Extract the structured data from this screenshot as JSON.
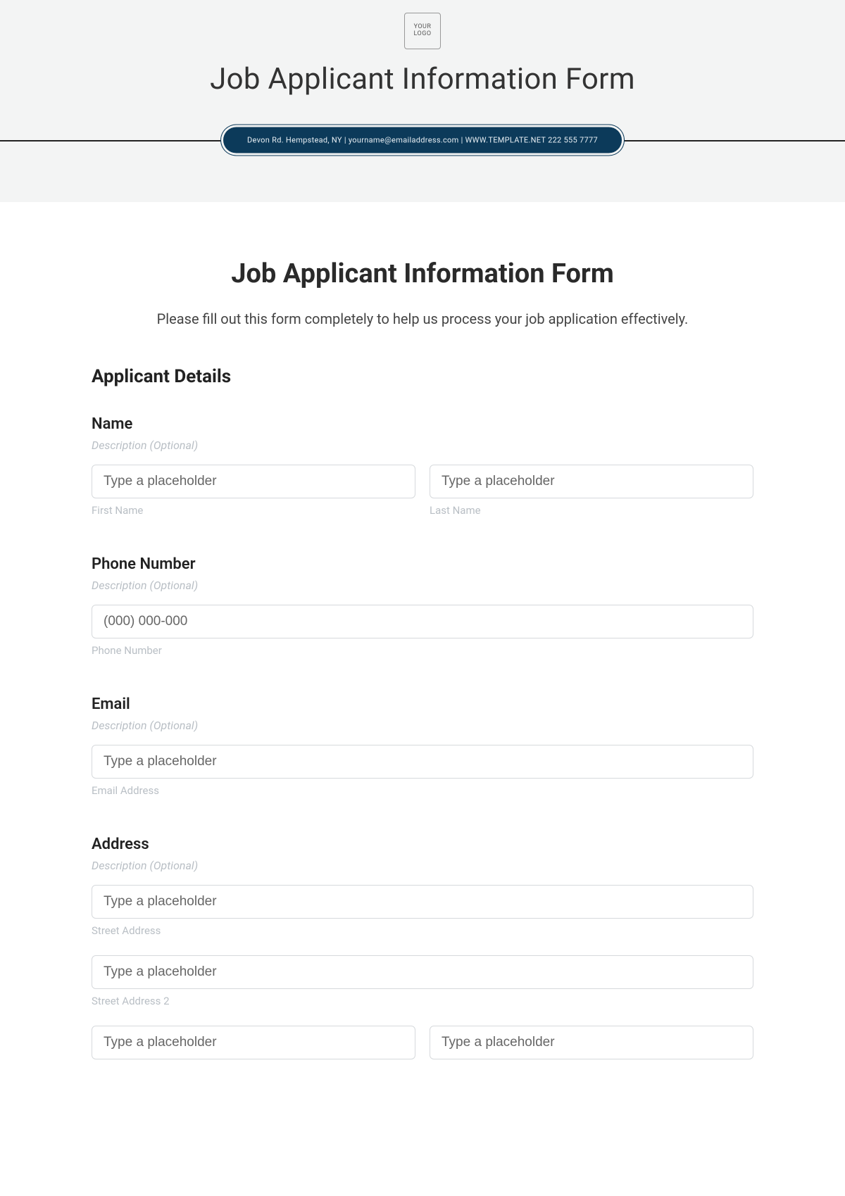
{
  "banner": {
    "logo_text": "YOUR LOGO",
    "title": "Job Applicant Information Form",
    "pill_text": "Devon Rd. Hempstead, NY | yourname@emailaddress.com | WWW.TEMPLATE.NET  222 555 7777"
  },
  "form": {
    "title": "Job Applicant Information Form",
    "intro": "Please fill out this form completely to help us process your job application effectively.",
    "section_heading": "Applicant Details",
    "name": {
      "label": "Name",
      "desc": "Description (Optional)",
      "first_placeholder": "Type a placeholder",
      "first_sub": "First Name",
      "last_placeholder": "Type a placeholder",
      "last_sub": "Last Name"
    },
    "phone": {
      "label": "Phone Number",
      "desc": "Description (Optional)",
      "placeholder": "(000) 000-000",
      "sub": "Phone Number"
    },
    "email": {
      "label": "Email",
      "desc": "Description (Optional)",
      "placeholder": "Type a placeholder",
      "sub": "Email Address"
    },
    "address": {
      "label": "Address",
      "desc": "Description (Optional)",
      "street1_placeholder": "Type a placeholder",
      "street1_sub": "Street Address",
      "street2_placeholder": "Type a placeholder",
      "street2_sub": "Street Address 2",
      "city_placeholder": "Type a placeholder",
      "state_placeholder": "Type a placeholder"
    }
  }
}
